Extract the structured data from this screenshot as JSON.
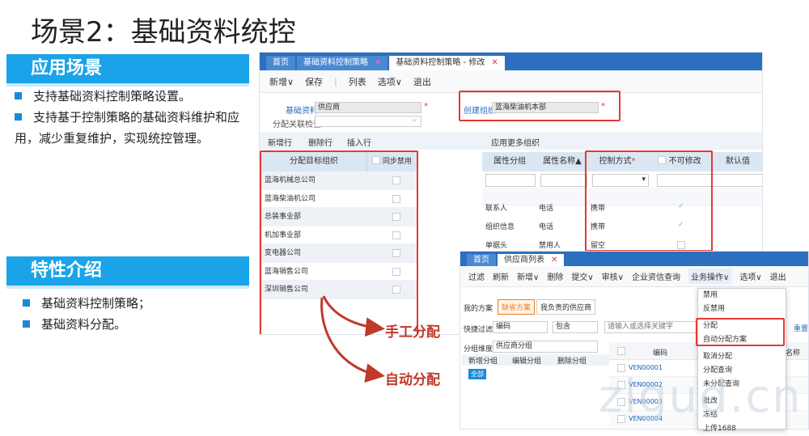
{
  "slide": {
    "title": "场景2：基础资料统控",
    "section1": "应用场景",
    "section1_bullets": [
      "支持基础资料控制策略设置。",
      "支持基于控制策略的基础资料维护和应用，减少重复维护，实现统控管理。"
    ],
    "section2": "特性介绍",
    "section2_bullets": [
      "基础资料控制策略；",
      "基础资料分配。"
    ],
    "annot_manual": "手工分配",
    "annot_auto": "自动分配",
    "watermark": "zigud.cn"
  },
  "shot1": {
    "tabs": [
      {
        "label": "首页"
      },
      {
        "label": "基础资料控制策略"
      },
      {
        "label": "基础资料控制策略 - 修改"
      }
    ],
    "toolbar": [
      "新增∨",
      "保存",
      "|",
      "列表",
      "选项∨",
      "退出"
    ],
    "basic_label": "基础资料",
    "basic_value": "供应商",
    "create_org_label": "创建组织",
    "create_org_value": "蓝海柴油机本部",
    "alloc_check_label": "分配关联检查",
    "actions_left": [
      "新增行",
      "删除行",
      "插入行"
    ],
    "actions_right": "应用更多组织",
    "left_grid": {
      "col1": "分配目标组织",
      "col2": "同步禁用",
      "rows": [
        "蓝海机械总公司",
        "蓝海柴油机公司",
        "总装事业部",
        "机加事业部",
        "变电器公司",
        "蓝海销售公司",
        "深圳销售公司"
      ]
    },
    "right_grid": {
      "headers": [
        "属性分组",
        "属性名称▲",
        "控制方式",
        "不可修改",
        "默认值"
      ],
      "rows": [
        {
          "group": "联系人",
          "name": "电话",
          "mode": "携带",
          "locked": true
        },
        {
          "group": "组织信息",
          "name": "电话",
          "mode": "携带",
          "locked": true
        },
        {
          "group": "单据头",
          "name": "禁用人",
          "mode": "留空",
          "locked": false
        }
      ]
    }
  },
  "shot2": {
    "tabs": [
      {
        "label": "首页"
      },
      {
        "label": "供应商列表"
      }
    ],
    "toolbar": [
      "过滤",
      "刷新",
      "新增∨",
      "删除",
      "提交∨",
      "审核∨",
      "企业资信查询",
      "业务操作∨",
      "选项∨",
      "退出"
    ],
    "scheme_label": "我的方案",
    "scheme_default": "缺省方案",
    "scheme_mine": "我负责的供应商",
    "quick_filter_label": "快捷过滤",
    "filter_field": "编码",
    "filter_op": "包含",
    "filter_placeholder": "请输入或选择关键字",
    "filter_extra": "重置",
    "group_dim_label": "分组维度",
    "group_dim_value": "供应商分组",
    "group_actions": [
      "新增分组",
      "编辑分组",
      "删除分组"
    ],
    "all_badge": "全部",
    "col_code": "编码",
    "col_name": "名称",
    "codes": [
      "VEN00001",
      "VEN00002",
      "VEN00003",
      "VEN00004"
    ]
  },
  "menu": {
    "items": [
      "禁用",
      "反禁用",
      "分配",
      "自动分配方案",
      "取消分配",
      "分配查询",
      "未分配查询",
      "批改",
      "冻结",
      "上传1688"
    ]
  }
}
